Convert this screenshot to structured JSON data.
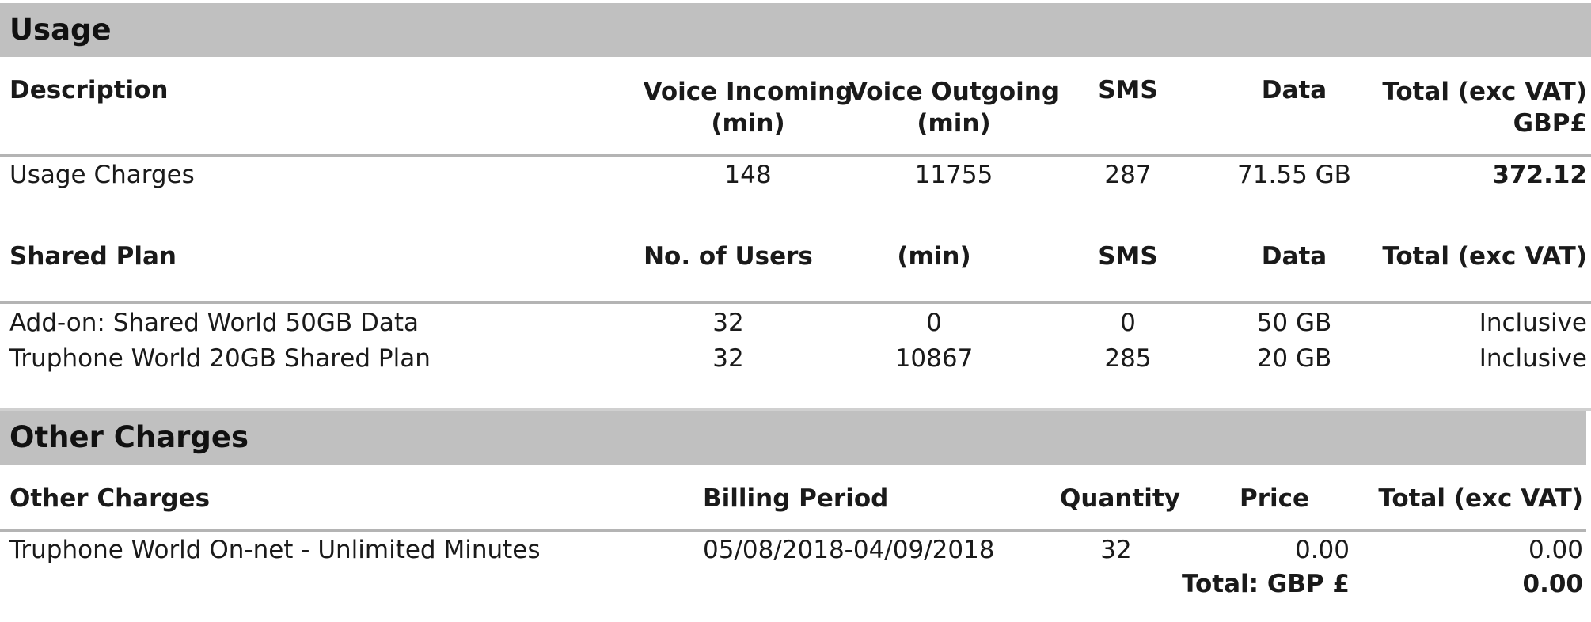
{
  "usage": {
    "section_title": "Usage",
    "header": {
      "description": "Description",
      "voice_in_line1": "Voice Incoming",
      "voice_in_line2": "(min)",
      "voice_out_line1": "Voice Outgoing",
      "voice_out_line2": "(min)",
      "sms": "SMS",
      "data": "Data",
      "total_line1": "Total (exc VAT)",
      "total_line2": "GBP£"
    },
    "row": {
      "description": "Usage Charges",
      "voice_in": "148",
      "voice_out": "11755",
      "sms": "287",
      "data": "71.55 GB",
      "total": "372.12"
    }
  },
  "shared_plan": {
    "header": {
      "description": "Shared Plan",
      "users": "No. of Users",
      "min": "(min)",
      "sms": "SMS",
      "data": "Data",
      "total": "Total (exc VAT)"
    },
    "rows": [
      {
        "description": "Add-on: Shared World 50GB Data",
        "users": "32",
        "min": "0",
        "sms": "0",
        "data": "50 GB",
        "total": "Inclusive"
      },
      {
        "description": "Truphone World 20GB Shared Plan",
        "users": "32",
        "min": "10867",
        "sms": "285",
        "data": "20 GB",
        "total": "Inclusive"
      }
    ]
  },
  "other_charges": {
    "section_title": "Other Charges",
    "header": {
      "description": "Other Charges",
      "billing_period": "Billing Period",
      "quantity": "Quantity",
      "price": "Price",
      "total": "Total (exc VAT)"
    },
    "rows": [
      {
        "description": "Truphone World On-net - Unlimited Minutes",
        "billing_period": "05/08/2018-04/09/2018",
        "quantity": "32",
        "price": "0.00",
        "total": "0.00"
      }
    ],
    "grand_total_label": "Total: GBP £",
    "grand_total_value": "0.00"
  },
  "colors": {
    "band": "#c0c0c0",
    "rule": "#b4b4b4",
    "text": "#1a1a1a"
  }
}
